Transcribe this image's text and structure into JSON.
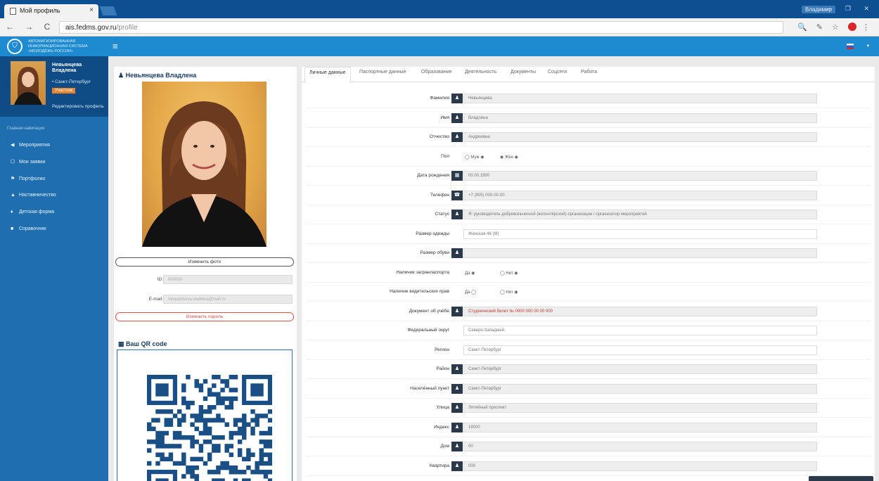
{
  "browser": {
    "tab_title": "Мой профиль",
    "tab_close": "×",
    "user_label": "Владимир",
    "window_controls": "— ❐ ✕",
    "nav_buttons": "← → C ⌂",
    "url_host": "ais.fedms.gov.ru",
    "url_path": "/profile",
    "extensions": "🔍 ✎ ☆"
  },
  "header": {
    "logo": "⛉",
    "title": "АВТОМАТИЗИРОВАННАЯ ИНФОРМАЦИОННАЯ СИСТЕМА «МОЛОДЁЖЬ РОССИИ»",
    "menu_icon": "≡",
    "header_icon": "▪"
  },
  "sidebar": {
    "user_name": "Невьянцева Владлена",
    "user_city": "• Санкт-Петербург",
    "user_badge": "Участник",
    "edit_link": "Редактировать профиль",
    "section_label": "Главная навигация",
    "items": [
      {
        "icon": "◀",
        "label": "Мероприятия"
      },
      {
        "icon": "☐",
        "label": "Мои заявки"
      },
      {
        "icon": "⚑",
        "label": "Портфолио"
      },
      {
        "icon": "▲",
        "label": "Наставничество"
      },
      {
        "icon": "♦",
        "label": "Детская форма"
      },
      {
        "icon": "■",
        "label": "Справочник"
      }
    ]
  },
  "profile_card": {
    "name": "♟ Невьянцева Владлена",
    "change_photo": "Изменить фото",
    "id_label": "ID:",
    "id_value": "000000",
    "email_label": "E-mail:",
    "email_value": "nevyantseva.vladlena@mail.ru",
    "change_password": "Изменить пароль"
  },
  "qr_card": {
    "title": "▦ Ваш QR code"
  },
  "tabs": [
    {
      "label": "Личные данные",
      "active": true
    },
    {
      "label": "Паспортные данные",
      "active": false
    },
    {
      "label": "Образование",
      "active": false
    },
    {
      "label": "Деятельность",
      "active": false
    },
    {
      "label": "Документы",
      "active": false
    },
    {
      "label": "Соцсети",
      "active": false
    },
    {
      "label": "Работа",
      "active": false
    }
  ],
  "form": {
    "rows": [
      {
        "label": "Фамилия",
        "icon": "♟",
        "value": "Невьянцева",
        "type": "icon"
      },
      {
        "label": "Имя",
        "icon": "♟",
        "value": "Владлена",
        "type": "icon"
      },
      {
        "label": "Отчество",
        "icon": "♟",
        "value": "Андреевна",
        "type": "icon"
      },
      {
        "label": "Пол",
        "type": "radio",
        "opt1": "◯ Муж ◉",
        "opt2": "◉ Жен ◉"
      },
      {
        "label": "Дата рождения",
        "icon": "▦",
        "value": "00.00.1990",
        "type": "icon"
      },
      {
        "label": "Телефон",
        "icon": "☎",
        "value": "+7 (905) 000-00-00",
        "type": "icon"
      },
      {
        "label": "Статус",
        "icon": "♟",
        "value": "Я: руководитель добровольческой (волонтёрской) организации / организатор мероприятий",
        "type": "icon"
      },
      {
        "label": "Размер одежды",
        "value": "Женская 46 (М)",
        "type": "plain"
      },
      {
        "label": "Размер обуви",
        "icon": "♟",
        "value": "",
        "type": "icon"
      },
      {
        "label": "Наличие загранпаспорта",
        "type": "radio",
        "opt1": "Да ◉",
        "opt2": "◯ Нет ◉"
      },
      {
        "label": "Наличие водительских прав",
        "type": "radio",
        "opt1": "Да ◯",
        "opt2": "◯ Нет ◉"
      },
      {
        "label": "Документ об учёбе",
        "icon": "♟",
        "value": "Студенческий билет № 0000 000 00 00 000",
        "type": "icon",
        "red": true
      },
      {
        "label": "Федеральный округ",
        "value": "Северо-Западный",
        "type": "plain"
      },
      {
        "label": "Регион",
        "value": "Санкт-Петербург",
        "type": "plain"
      },
      {
        "label": "Район",
        "icon": "♟",
        "value": "Санкт-Петербург",
        "type": "icon"
      },
      {
        "label": "Населённый пункт",
        "icon": "♟",
        "value": "Санкт-Петербург",
        "type": "icon"
      },
      {
        "label": "Улица",
        "icon": "♟",
        "value": "Литейный проспект",
        "type": "icon"
      },
      {
        "label": "Индекс",
        "icon": "♟",
        "value": "19000",
        "type": "icon"
      },
      {
        "label": "Дом",
        "icon": "♟",
        "value": "00",
        "type": "icon"
      },
      {
        "label": "Квартира",
        "icon": "♟",
        "value": "000",
        "type": "icon"
      }
    ]
  },
  "colors": {
    "brand_blue": "#1e8bd0",
    "sidebar": "#1f6eb0",
    "sidebar_dark": "#0f4c86",
    "badge": "#e8832b",
    "danger": "#d9534f",
    "icon_bg": "#2b3a4a"
  }
}
